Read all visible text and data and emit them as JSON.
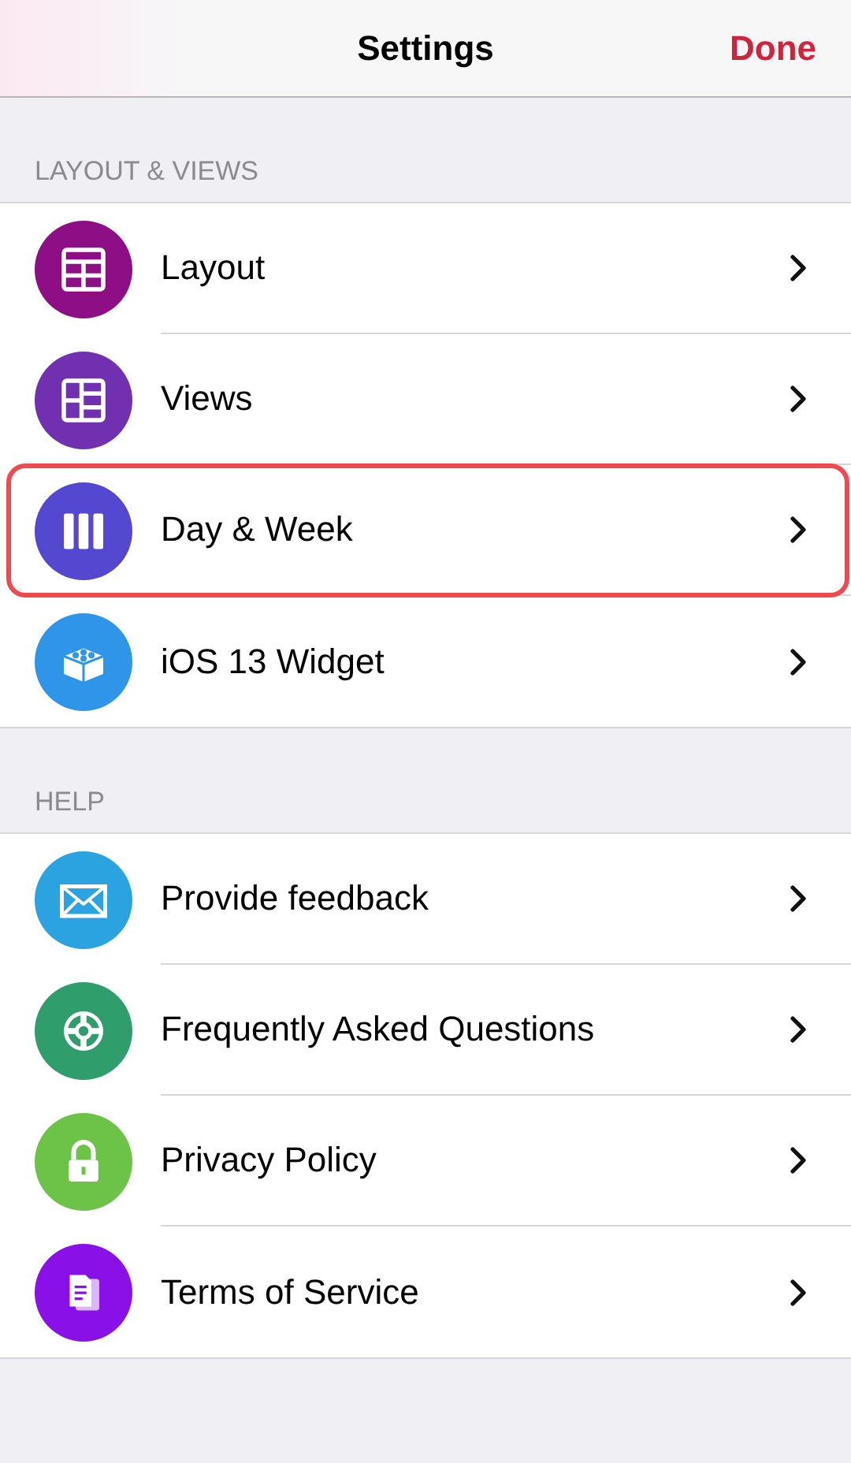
{
  "nav_bar": {
    "title": "Settings",
    "done_button": "Done"
  },
  "sections": [
    {
      "header": "LAYOUT & VIEWS",
      "items": [
        {
          "label": "Layout",
          "kind": "table",
          "color": "#8e0e86",
          "highlighted": false
        },
        {
          "label": "Views",
          "kind": "grid",
          "color": "#7030b0",
          "highlighted": false
        },
        {
          "label": "Day & Week",
          "kind": "columns",
          "color": "#5448d0",
          "highlighted": true
        },
        {
          "label": "iOS 13 Widget",
          "kind": "cube",
          "color": "#2f95e8",
          "highlighted": false
        }
      ]
    },
    {
      "header": "HELP",
      "items": [
        {
          "label": "Provide feedback",
          "kind": "envelope",
          "color": "#2aa3e0",
          "highlighted": false
        },
        {
          "label": "Frequently Asked Questions",
          "kind": "lifebuoy",
          "color": "#2f9e6c",
          "highlighted": false
        },
        {
          "label": "Privacy Policy",
          "kind": "lock",
          "color": "#6cc348",
          "highlighted": false
        },
        {
          "label": "Terms of Service",
          "kind": "document",
          "color": "#8a10e8",
          "highlighted": false
        }
      ]
    }
  ]
}
